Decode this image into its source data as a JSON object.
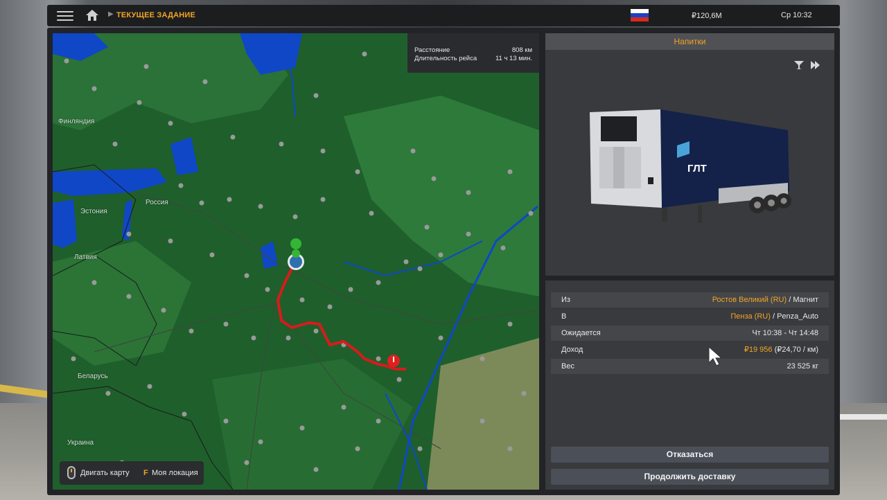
{
  "header": {
    "breadcrumb_title": "ТЕКУЩЕЕ ЗАДАНИЕ",
    "money": "₽120,6M",
    "clock": "Ср 10:32",
    "icons": [
      "menu-icon",
      "home-icon",
      "chevron-right-icon",
      "russia-flag-icon"
    ]
  },
  "route_info": {
    "distance_label": "Расстояние",
    "distance_value": "808 км",
    "duration_label": "Длительность рейса",
    "duration_value": "11 ч 13 мин."
  },
  "map": {
    "labels": {
      "finland": "Финляндия",
      "estonia": "Эстония",
      "russia": "Россия",
      "latvia": "Латвия",
      "belarus": "Беларусь",
      "ukraine": "Украина"
    },
    "colors": {
      "land": "#1f5f2c",
      "water": "#0f47c7",
      "route": "#d81b1b",
      "start": "#35b534",
      "end": "#e02020"
    }
  },
  "map_controls": {
    "move_label": "Двигать карту",
    "location_key": "F",
    "location_label": "Моя локация"
  },
  "cargo": {
    "title": "Напитки",
    "icons": [
      "cocktail-icon",
      "fast-forward-icon"
    ],
    "trailer_brand": "ГЛТ"
  },
  "details": {
    "from_label": "Из",
    "from_city": "Ростов Великий (RU)",
    "from_company": "Магнит",
    "to_label": "В",
    "to_city": "Пенза (RU)",
    "to_company": "Penza_Auto",
    "expected_label": "Ожидается",
    "expected_value": "Чт 10:38 - Чт 14:48",
    "income_label": "Доход",
    "income_value": "₽19 956",
    "income_per_km": "(₽24,70 / км)",
    "weight_label": "Вес",
    "weight_value": "23 525 кг"
  },
  "buttons": {
    "decline": "Отказаться",
    "continue": "Продолжить доставку"
  },
  "colors": {
    "accent": "#f2a526",
    "panel": "#393a3d",
    "button": "#4a4f58"
  }
}
